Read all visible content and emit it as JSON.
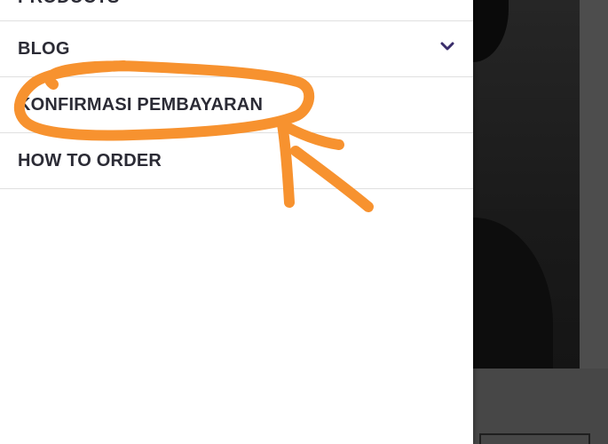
{
  "drawer": {
    "menu": [
      {
        "label": "PRODUCTS",
        "partial": true
      },
      {
        "label": "BLOG",
        "has_submenu": true,
        "submenu_icon": "chevron-down-icon"
      },
      {
        "label": "KONFIRMASI PEMBAYARAN"
      },
      {
        "label": "HOW TO ORDER"
      }
    ]
  },
  "annotation": {
    "color": "#F7922F",
    "marks": [
      "circle-highlight",
      "arrow-pointer"
    ]
  },
  "colors": {
    "menu_text": "#2B2B35",
    "chevron": "#3A2D6B",
    "divider": "#E0E0E0",
    "overlay": "#4A4A4A"
  }
}
